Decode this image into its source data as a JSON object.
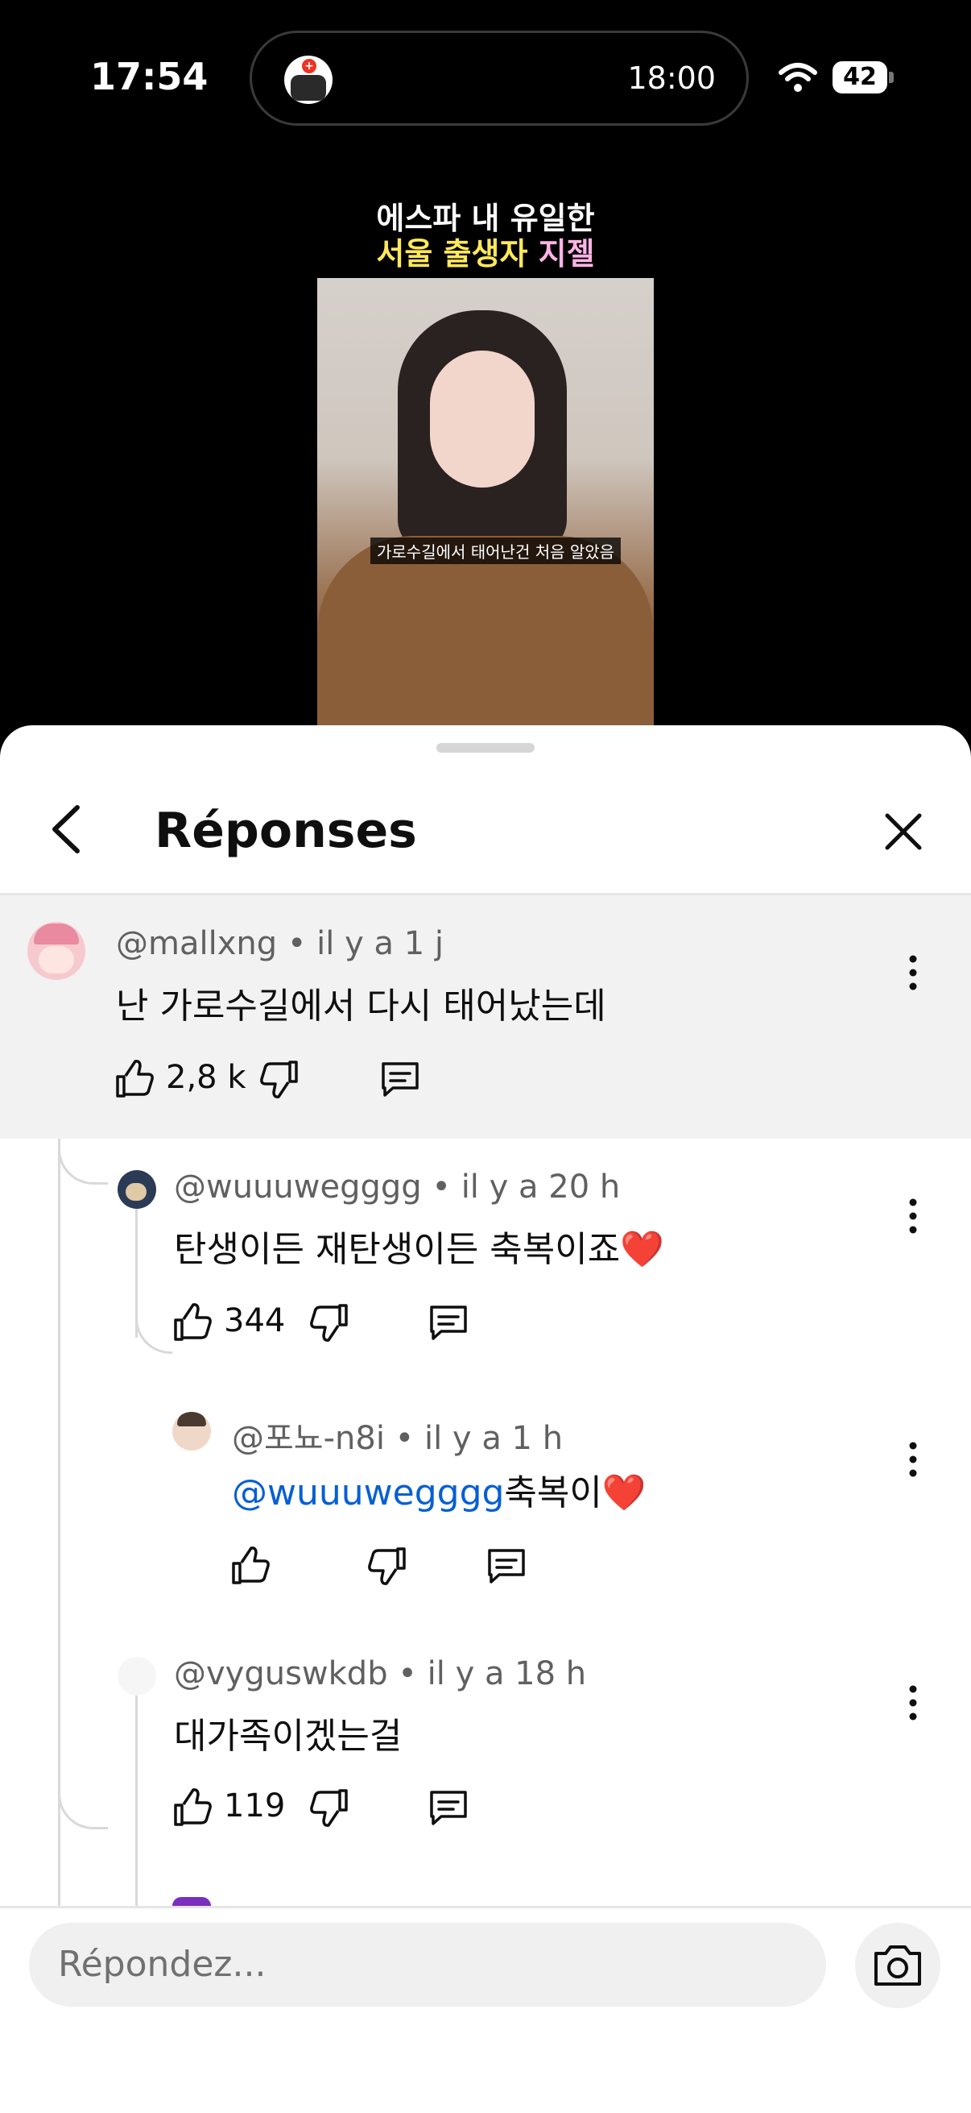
{
  "status_bar": {
    "time": "17:54",
    "island_time": "18:00",
    "battery": "42"
  },
  "video": {
    "title_line1": "에스파 내 유일한",
    "title_line2_a": "서울 출생자 ",
    "title_line2_b": "지젤",
    "subtitle": "가로수길에서 태어난건 처음 알았음"
  },
  "sheet": {
    "title": "Réponses"
  },
  "comments": [
    {
      "handle": "@mallxng",
      "time": "il y a 1 j",
      "text": "난 가로수길에서 다시 태어났는데",
      "likes": "2,8 k"
    },
    {
      "handle": "@wuuuwegggg",
      "time": "il y a 20 h",
      "text": "탄생이든 재탄생이든 축복이죠",
      "emoji": "❤️",
      "likes": "344"
    },
    {
      "handle": "@포뇨-n8i",
      "time": "il y a 1 h",
      "mention": "@wuuuwegggg",
      "text": "축복이",
      "emoji": "❤️",
      "likes": ""
    },
    {
      "handle": "@vyguswkdb",
      "time": "il y a 18 h",
      "text": "대가족이겠는걸",
      "likes": "119"
    }
  ],
  "separator": " • ",
  "reply_input": {
    "placeholder": "Répondez..."
  },
  "colors": {
    "mention": "#065fd4",
    "parent_bg": "#f2f2f2",
    "heart": "#e0202e"
  }
}
